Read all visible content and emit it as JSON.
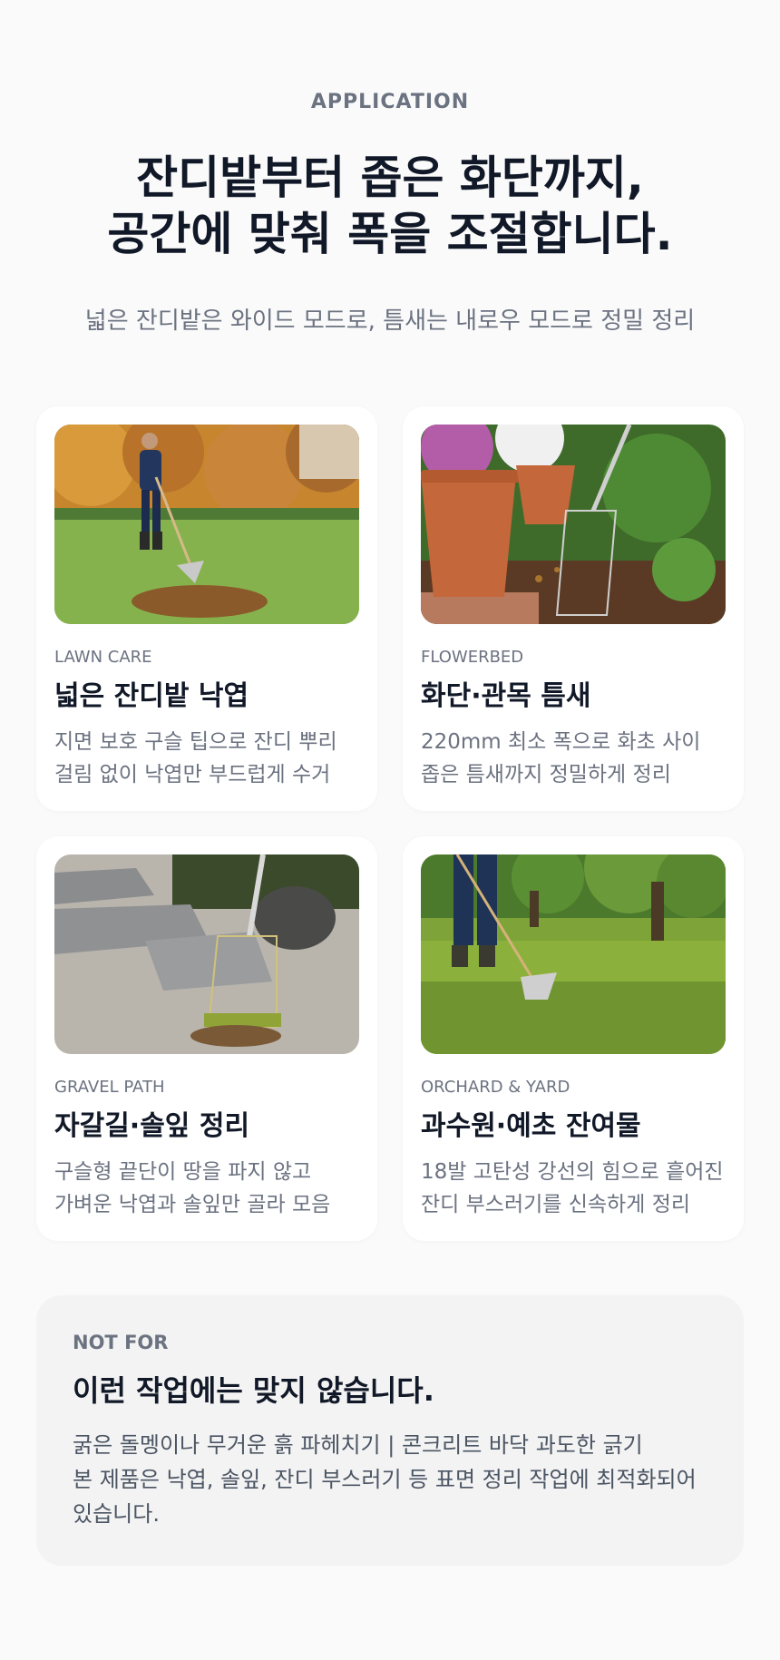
{
  "header": {
    "eyebrow": "APPLICATION",
    "headline_line1": "잔디밭부터 좁은 화단까지,",
    "headline_line2": "공간에 맞춰 폭을 조절합니다.",
    "subhead": "넓은 잔디밭은 와이드 모드로, 틈새는 내로우 모드로 정밀 정리"
  },
  "cards": [
    {
      "tag": "LAWN CARE",
      "title": "넓은 잔디밭 낙엽",
      "desc_line1": "지면 보호 구슬 팁으로 잔디 뿌리",
      "desc_line2": "걸림 없이 낙엽만 부드럽게 수거"
    },
    {
      "tag": "FLOWERBED",
      "title": "화단·관목 틈새",
      "desc_line1": "220mm 최소 폭으로 화초 사이",
      "desc_line2": "좁은 틈새까지 정밀하게 정리"
    },
    {
      "tag": "GRAVEL PATH",
      "title": "자갈길·솔잎 정리",
      "desc_line1": "구슬형 끝단이 땅을 파지 않고",
      "desc_line2": "가벼운 낙엽과 솔잎만 골라 모음"
    },
    {
      "tag": "ORCHARD & YARD",
      "title": "과수원·예초 잔여물",
      "desc_line1": "18발 고탄성 강선의 힘으로 흩어진",
      "desc_line2": "잔디 부스러기를 신속하게 정리"
    }
  ],
  "not_for": {
    "tag": "NOT FOR",
    "title": "이런 작업에는 맞지 않습니다.",
    "desc_line1": "굵은 돌멩이나 무거운 흙 파헤치기 | 콘크리트 바닥 과도한 긁기",
    "desc_line2": "본 제품은 낙엽, 솔잎, 잔디 부스러기 등 표면 정리 작업에 최적화되어",
    "desc_line3": "있습니다."
  },
  "colors": {
    "background": "#fafafa",
    "card": "#ffffff",
    "heading": "#111827",
    "muted": "#6b7280",
    "notfor_bg": "#f3f3f3"
  }
}
